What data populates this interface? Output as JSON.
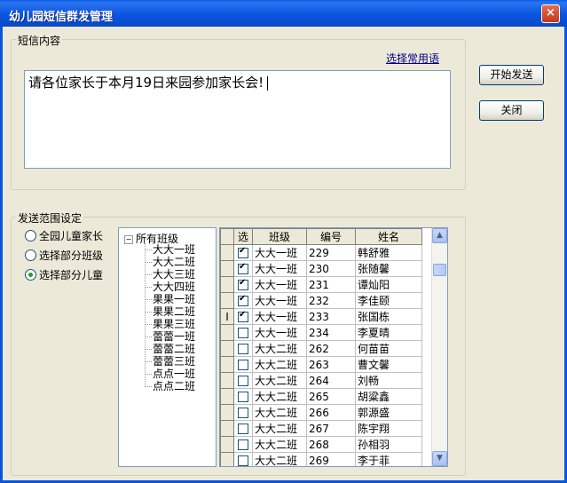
{
  "window": {
    "title": "幼儿园短信群发管理",
    "close": "×"
  },
  "message": {
    "group_label": "短信内容",
    "template_link": "选择常用语",
    "text": "请各位家长于本月19日来园参加家长会!"
  },
  "buttons": {
    "send": "开始发送",
    "close": "关闭"
  },
  "scope": {
    "group_label": "发送范围设定",
    "options": [
      {
        "label": "全园儿童家长",
        "selected": false
      },
      {
        "label": "选择部分班级",
        "selected": false
      },
      {
        "label": "选择部分儿童",
        "selected": true
      }
    ]
  },
  "tree": {
    "root_expander": "−",
    "root": "所有班级",
    "classes": [
      "大大一班",
      "大大二班",
      "大大三班",
      "大大四班",
      "果果一班",
      "果果二班",
      "果果三班",
      "蕾蕾一班",
      "蕾蕾二班",
      "蕾蕾三班",
      "点点一班",
      "点点二班"
    ]
  },
  "grid": {
    "columns": [
      "选",
      "班级",
      "编号",
      "姓名"
    ],
    "current_row_marker": "I",
    "rows": [
      {
        "checked": true,
        "class": "大大一班",
        "id": "229",
        "name": "韩舒雅"
      },
      {
        "checked": true,
        "class": "大大一班",
        "id": "230",
        "name": "张随馨"
      },
      {
        "checked": true,
        "class": "大大一班",
        "id": "231",
        "name": "谭灿阳"
      },
      {
        "checked": true,
        "class": "大大一班",
        "id": "232",
        "name": "李佳颐"
      },
      {
        "checked": true,
        "class": "大大一班",
        "id": "233",
        "name": "张国栋"
      },
      {
        "checked": false,
        "class": "大大一班",
        "id": "234",
        "name": "李夏晴"
      },
      {
        "checked": false,
        "class": "大大二班",
        "id": "262",
        "name": "何苗苗"
      },
      {
        "checked": false,
        "class": "大大二班",
        "id": "263",
        "name": "曹文馨"
      },
      {
        "checked": false,
        "class": "大大二班",
        "id": "264",
        "name": "刘畅"
      },
      {
        "checked": false,
        "class": "大大二班",
        "id": "265",
        "name": "胡粱鑫"
      },
      {
        "checked": false,
        "class": "大大二班",
        "id": "266",
        "name": "郭源盛"
      },
      {
        "checked": false,
        "class": "大大二班",
        "id": "267",
        "name": "陈宇翔"
      },
      {
        "checked": false,
        "class": "大大二班",
        "id": "268",
        "name": "孙相羽"
      },
      {
        "checked": false,
        "class": "大大二班",
        "id": "269",
        "name": "李于菲"
      }
    ],
    "current_row": 4
  }
}
